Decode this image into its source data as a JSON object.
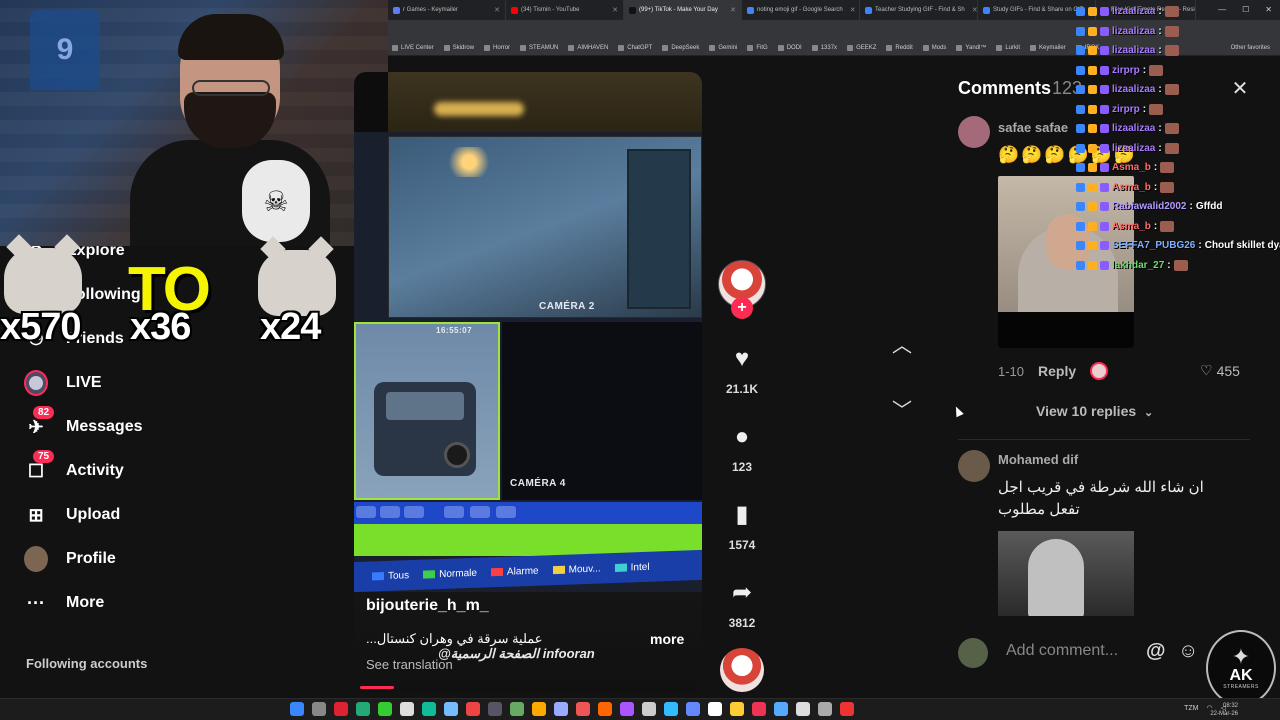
{
  "browser": {
    "tabs": [
      {
        "label": "r Games - Keymailer",
        "color": "#5c7cfa"
      },
      {
        "label": "(34) Tismin - YouTube",
        "color": "#ff0000"
      },
      {
        "label": "(99+) TikTok - Make Your Day",
        "color": "#111111",
        "active": true
      },
      {
        "label": "noting emoji gif - Google Search",
        "color": "#4285f4"
      },
      {
        "label": "Teacher Studying GIF - Find & Sh",
        "color": "#3a86ff"
      },
      {
        "label": "Study GIFs - Find & Share on GIF",
        "color": "#3a86ff"
      },
      {
        "label": "Free Kick Emote Resizer - Resize",
        "color": "#e6b800"
      }
    ],
    "bookmarks": [
      "LIVE Center",
      "Skidrow",
      "Horror",
      "STEAMUN",
      "AIMHAVEN",
      "ChatGPT",
      "DeepSeek",
      "Gemini",
      "FitG",
      "DODI",
      "1337x",
      "GEEKZ",
      "Reddit",
      "Mods",
      "Yandl™",
      "Lurkit",
      "Keymailer",
      "IROK"
    ],
    "other_favorites": "Other favorites"
  },
  "overlay": {
    "to_text": "TO",
    "counts": [
      "x570",
      "x36",
      "x24"
    ]
  },
  "sidebar": {
    "items": [
      {
        "label": "Explore",
        "icon": "compass-icon",
        "glyph": "⊘"
      },
      {
        "label": "Following",
        "icon": "following-icon",
        "glyph": "⚇"
      },
      {
        "label": "Friends",
        "icon": "friends-icon",
        "glyph": "⚇"
      },
      {
        "label": "LIVE",
        "icon": "live-icon",
        "glyph": ""
      },
      {
        "label": "Messages",
        "icon": "messages-icon",
        "glyph": "✈",
        "badge": "82"
      },
      {
        "label": "Activity",
        "icon": "activity-icon",
        "glyph": "☐",
        "badge": "75"
      },
      {
        "label": "Upload",
        "icon": "upload-icon",
        "glyph": "⊞"
      },
      {
        "label": "Profile",
        "icon": "profile-icon",
        "glyph": ""
      },
      {
        "label": "More",
        "icon": "more-icon",
        "glyph": "···"
      }
    ],
    "following_accounts": "Following accounts"
  },
  "video": {
    "cam_labels": [
      "CAMÉRA 2",
      "CAMÉRA 4"
    ],
    "timestamp": "16:55:07",
    "legend": [
      "Tous",
      "Normale",
      "Alarme",
      "Mouv...",
      "Intel"
    ],
    "author": "bijouterie_h_m_",
    "caption": "عملية سرقة في وهران كنستال...",
    "more": "more",
    "watermark": "@الصفحة الرسمية infooran",
    "see_translation": "See translation",
    "progress": 0.1
  },
  "actions": {
    "likes": "21.1K",
    "comments": "123",
    "saves": "1574",
    "shares": "3812"
  },
  "comments": {
    "title": "Comments",
    "count": "123",
    "items": [
      {
        "user": "safae safae",
        "emojis": "🤔🤔🤔🤔🤔🤔",
        "date": "1-10",
        "reply": "Reply",
        "likes": "455",
        "view_replies": "View 10 replies"
      },
      {
        "user": "Mohamed dif",
        "text": "ان شاء الله شرطة في قريب اجل تفعل مطلوب"
      }
    ],
    "add_placeholder": "Add comment...",
    "at_symbol": "@",
    "emoji_symbol": "☺"
  },
  "chat": {
    "messages": [
      {
        "user": "lizaalizaa",
        "text": "",
        "color": "#a77bff"
      },
      {
        "user": "lizaalizaa",
        "text": "",
        "color": "#a77bff"
      },
      {
        "user": "lizaalizaa",
        "text": "",
        "color": "#a77bff"
      },
      {
        "user": "zirprp",
        "text": "",
        "color": "#a77bff"
      },
      {
        "user": "lizaalizaa",
        "text": "",
        "color": "#a77bff"
      },
      {
        "user": "zirprp",
        "text": "",
        "color": "#a77bff"
      },
      {
        "user": "lizaalizaa",
        "text": "",
        "color": "#a77bff"
      },
      {
        "user": "lizaalizaa",
        "text": "",
        "color": "#a77bff"
      },
      {
        "user": "Asma_b",
        "text": "",
        "color": "#ff6b6b"
      },
      {
        "user": "Asma_b",
        "text": "",
        "color": "#ff6b6b"
      },
      {
        "user": "Rabiawalid2002",
        "text": "Gffdd",
        "color": "#b39cff"
      },
      {
        "user": "Asma_b",
        "text": "",
        "color": "#ff6b6b"
      },
      {
        "user": "SEFFA7_PUBG26",
        "text": "Chouf skillet dyalo",
        "color": "#7fb0ff"
      },
      {
        "user": "lakhdar_27",
        "text": "",
        "color": "#6ddc6d"
      }
    ]
  },
  "logo": {
    "ak": "AK",
    "sub": "STREAMERS"
  },
  "taskbar": {
    "lang": "TZM",
    "time": "08:32",
    "date": "22-Mar-26"
  },
  "colors": {
    "accent": "#fe2c55",
    "background": "#121212"
  }
}
